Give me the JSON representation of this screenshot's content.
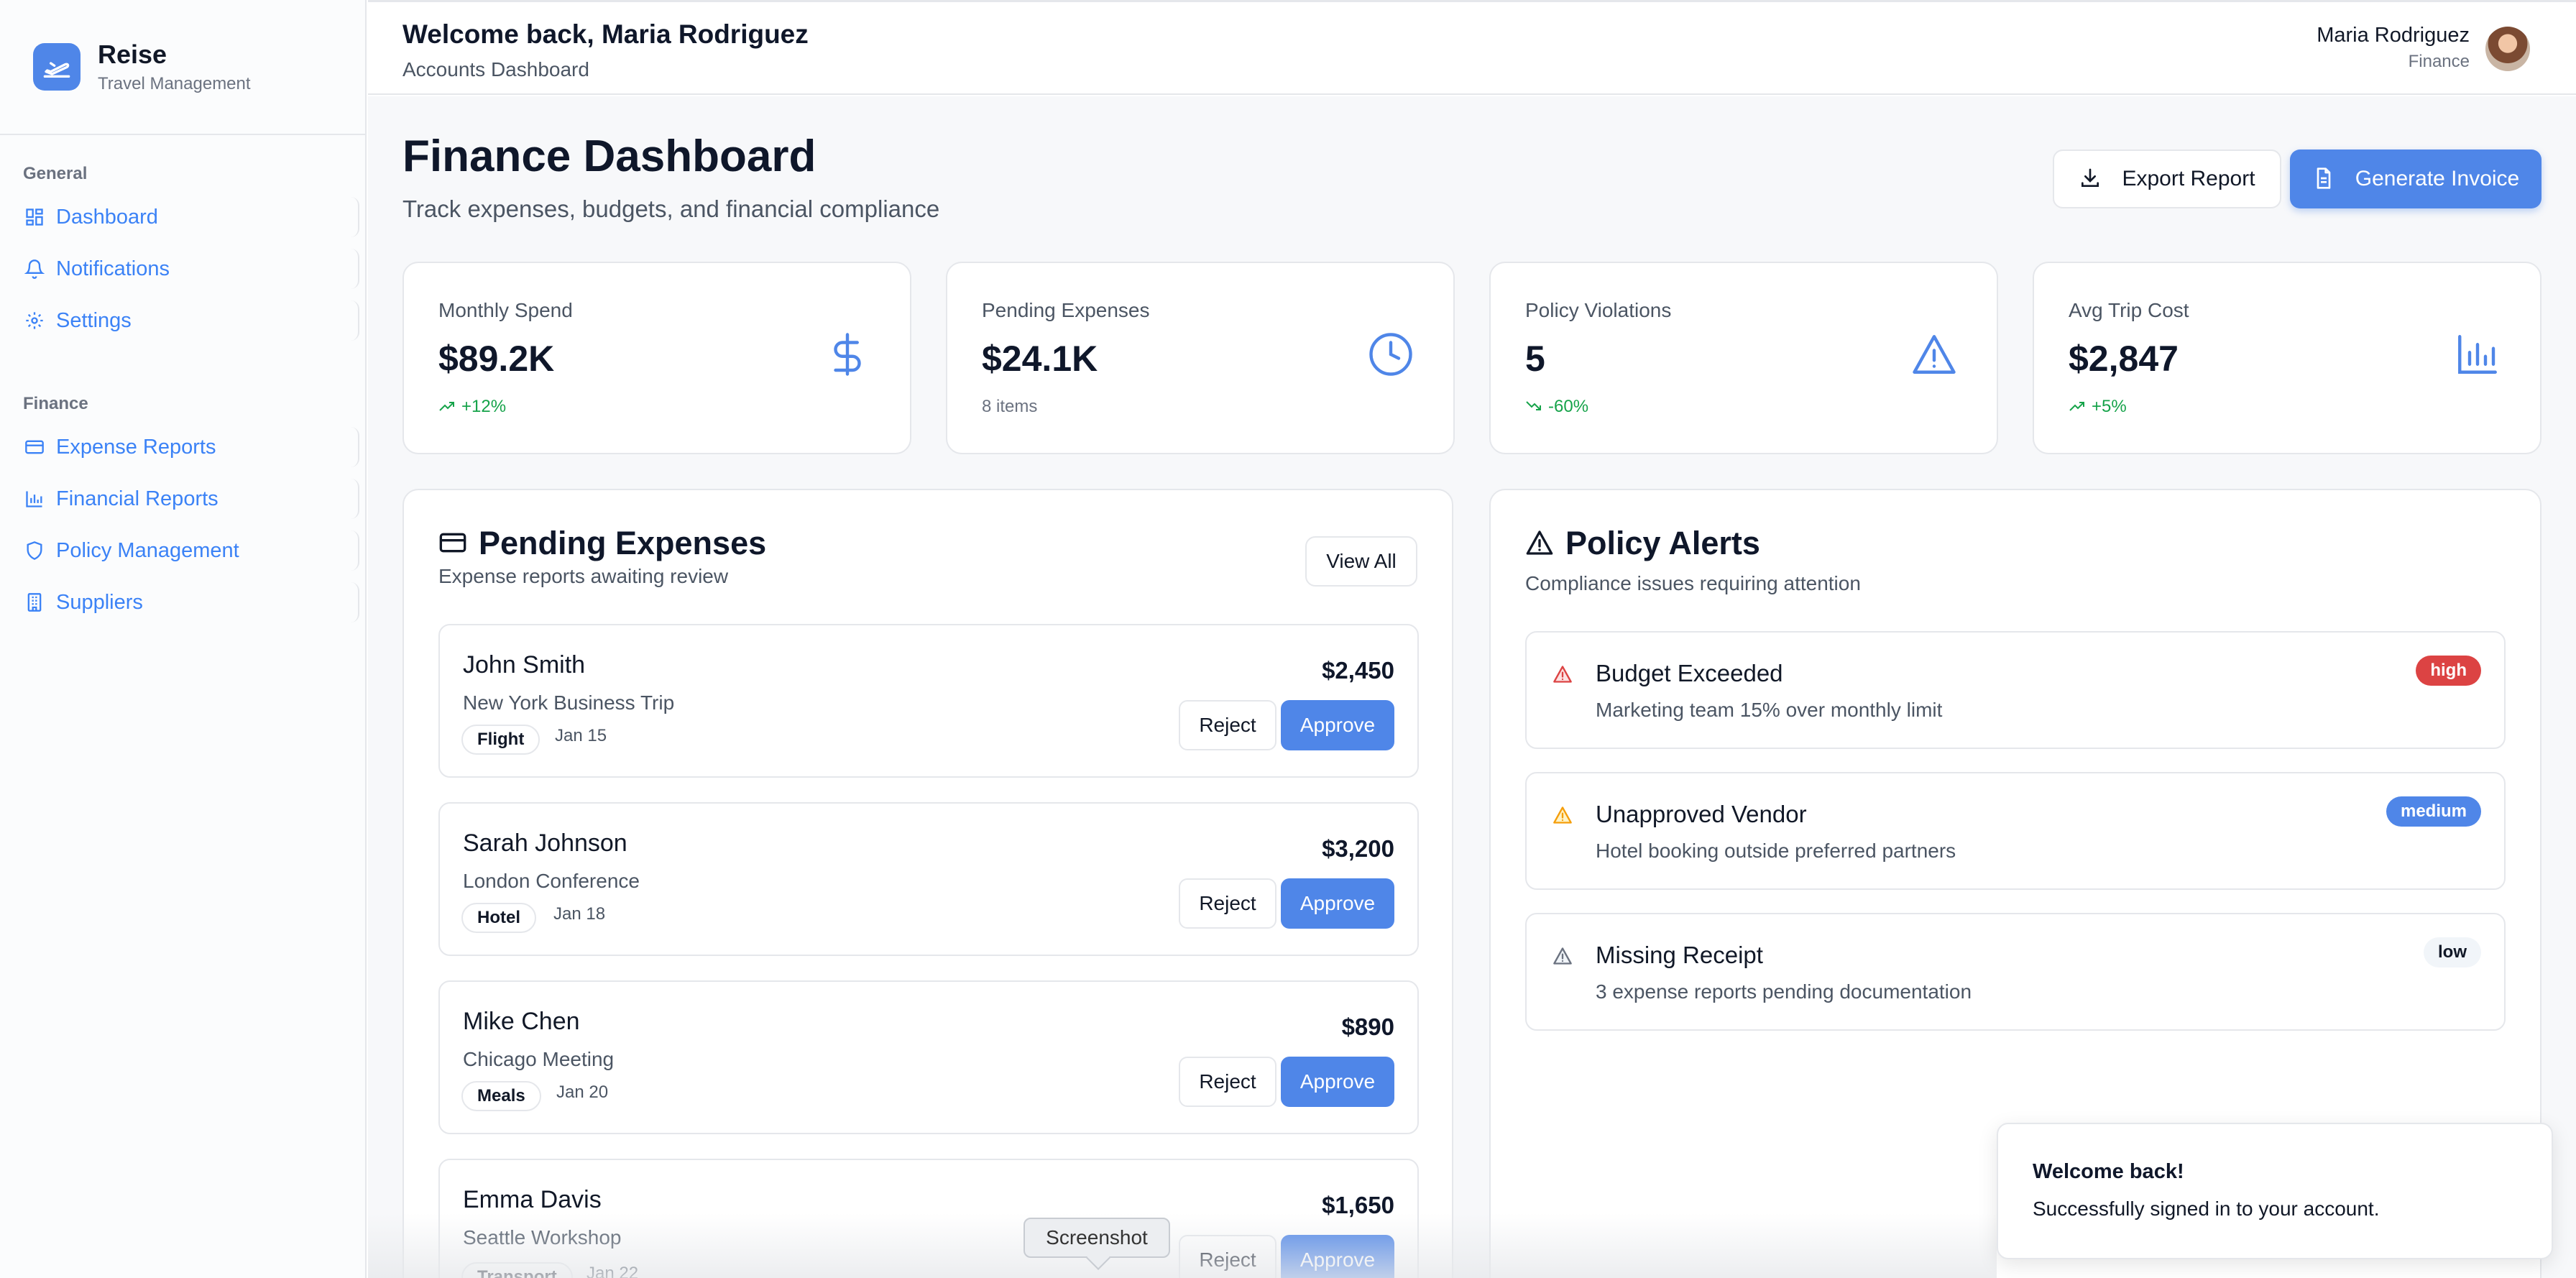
{
  "brand": {
    "name": "Reise",
    "subtitle": "Travel Management"
  },
  "sidebar": {
    "groups": [
      {
        "label": "General",
        "items": [
          {
            "label": "Dashboard",
            "icon": "grid-icon"
          },
          {
            "label": "Notifications",
            "icon": "bell-icon"
          },
          {
            "label": "Settings",
            "icon": "gear-icon"
          }
        ]
      },
      {
        "label": "Finance",
        "items": [
          {
            "label": "Expense Reports",
            "icon": "credit-card-icon"
          },
          {
            "label": "Financial Reports",
            "icon": "bar-chart-icon"
          },
          {
            "label": "Policy Management",
            "icon": "shield-icon"
          },
          {
            "label": "Suppliers",
            "icon": "building-icon"
          }
        ]
      }
    ]
  },
  "header": {
    "welcome": "Welcome back, Maria Rodriguez",
    "subtitle": "Accounts Dashboard",
    "user": {
      "name": "Maria Rodriguez",
      "role": "Finance"
    }
  },
  "page": {
    "title": "Finance Dashboard",
    "subtitle": "Track expenses, budgets, and financial compliance",
    "export_label": "Export Report",
    "invoice_label": "Generate Invoice"
  },
  "stats": [
    {
      "label": "Monthly Spend",
      "value": "$89.2K",
      "note": "+12%",
      "icon": "dollar-icon"
    },
    {
      "label": "Pending Expenses",
      "value": "$24.1K",
      "note": "8 items",
      "icon": "clock-icon"
    },
    {
      "label": "Policy Violations",
      "value": "5",
      "note": "-60%",
      "icon": "warning-icon"
    },
    {
      "label": "Avg Trip Cost",
      "value": "$2,847",
      "note": "+5%",
      "icon": "bar-chart-icon"
    }
  ],
  "pending": {
    "title": "Pending Expenses",
    "subtitle": "Expense reports awaiting review",
    "view_all": "View All",
    "reject_label": "Reject",
    "approve_label": "Approve",
    "items": [
      {
        "name": "John Smith",
        "trip": "New York Business Trip",
        "category": "Flight",
        "date": "Jan 15",
        "amount": "$2,450"
      },
      {
        "name": "Sarah Johnson",
        "trip": "London Conference",
        "category": "Hotel",
        "date": "Jan 18",
        "amount": "$3,200"
      },
      {
        "name": "Mike Chen",
        "trip": "Chicago Meeting",
        "category": "Meals",
        "date": "Jan 20",
        "amount": "$890"
      },
      {
        "name": "Emma Davis",
        "trip": "Seattle Workshop",
        "category": "Transport",
        "date": "Jan 22",
        "amount": "$1,650"
      }
    ]
  },
  "alerts": {
    "title": "Policy Alerts",
    "subtitle": "Compliance issues requiring attention",
    "items": [
      {
        "title": "Budget Exceeded",
        "desc": "Marketing team 15% over monthly limit",
        "severity": "high"
      },
      {
        "title": "Unapproved Vendor",
        "desc": "Hotel booking outside preferred partners",
        "severity": "medium"
      },
      {
        "title": "Missing Receipt",
        "desc": "3 expense reports pending documentation",
        "severity": "low"
      }
    ]
  },
  "toast": {
    "title": "Welcome back!",
    "desc": "Successfully signed in to your account."
  },
  "tooltip": {
    "label": "Screenshot"
  },
  "colors": {
    "accent": "#4f86e8",
    "positive": "#16a34a",
    "high": "#dc4343",
    "medium": "#4f86e8",
    "low": "#f1f5f9",
    "warning": "#f59e0b"
  }
}
